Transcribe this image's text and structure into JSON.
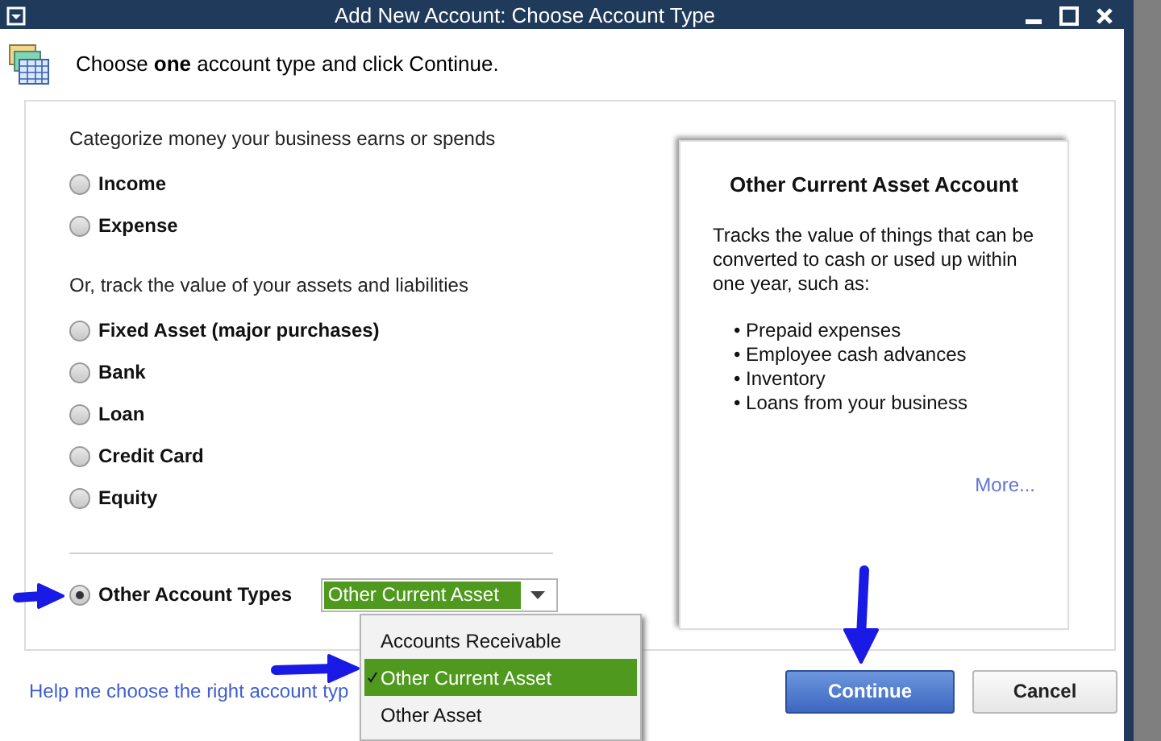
{
  "window": {
    "title": "Add New Account: Choose Account Type"
  },
  "instruction": "Choose **one** account type and click Continue.",
  "sections": [
    {
      "heading": "Categorize money your business earns or spends",
      "options": [
        {
          "label": "Income",
          "selected": false
        },
        {
          "label": "Expense",
          "selected": false
        }
      ]
    },
    {
      "heading": "Or, track the value of your assets and liabilities",
      "options": [
        {
          "label": "Fixed Asset (major purchases)",
          "selected": false
        },
        {
          "label": "Bank",
          "selected": false
        },
        {
          "label": "Loan",
          "selected": false
        },
        {
          "label": "Credit Card",
          "selected": false
        },
        {
          "label": "Equity",
          "selected": false
        }
      ]
    }
  ],
  "other_types": {
    "label": "Other Account Types",
    "selected": true,
    "value": "Other Current Asset",
    "expanded": true,
    "options": [
      {
        "label": "Accounts Receivable",
        "selected": false
      },
      {
        "label": "Other Current Asset",
        "selected": true
      },
      {
        "label": "Other Asset",
        "selected": false
      }
    ]
  },
  "description": {
    "title": "Other Current Asset Account",
    "text": "Tracks the value of things that can be converted to cash or used up within one year, such as:",
    "bullets": [
      "• Prepaid expenses",
      "• Employee cash advances",
      "• Inventory",
      "• Loans from your business"
    ],
    "more_link": "More..."
  },
  "help_link": "Help me choose the right account typ",
  "buttons": [
    {
      "label": "Continue",
      "kind": "primary"
    },
    {
      "label": "Cancel",
      "kind": "secondary"
    }
  ]
}
